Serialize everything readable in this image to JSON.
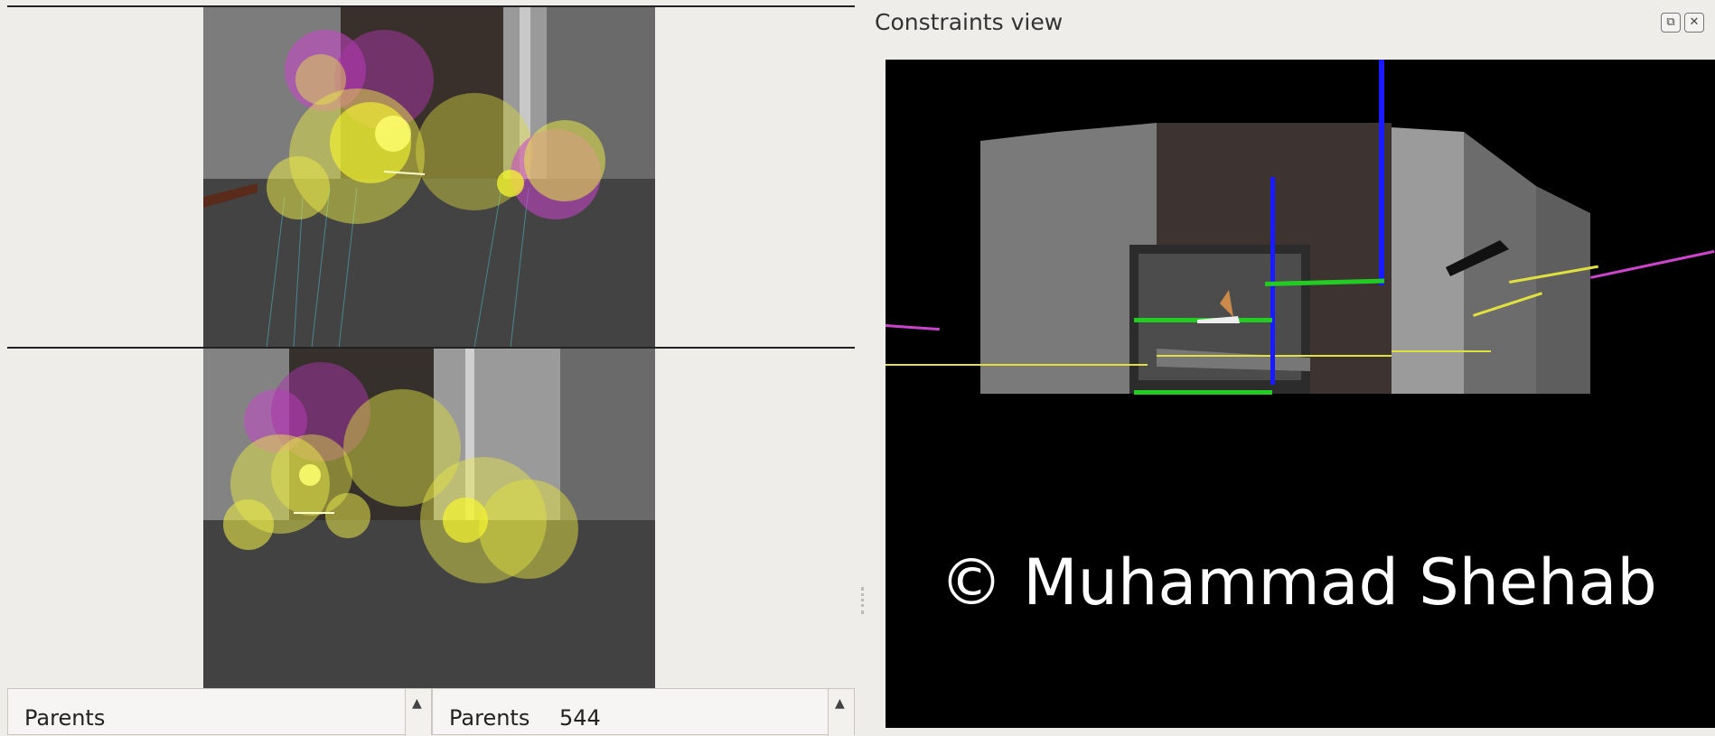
{
  "left_panel": {
    "parents_left": {
      "label": "Parents",
      "value": ""
    },
    "parents_right": {
      "label": "Parents",
      "value": "544"
    }
  },
  "right_panel": {
    "title": "Constraints view",
    "watermark": "© Muhammad Shehab"
  },
  "icons": {
    "scroll_up": "▲",
    "float": "⧉",
    "close": "✕"
  },
  "colors": {
    "feature_yellow": "#e8e84a",
    "feature_magenta": "#cc44cc",
    "constraint_green": "#22cc22",
    "pose_blue": "#1a1aff",
    "viewport_bg": "#000000"
  }
}
